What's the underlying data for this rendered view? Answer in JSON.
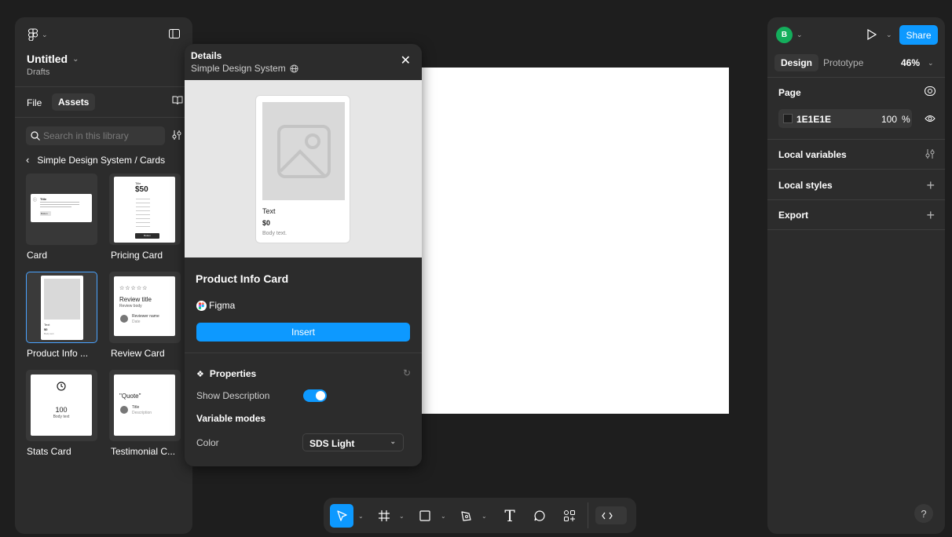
{
  "left_panel": {
    "file_title": "Untitled",
    "location": "Drafts",
    "tabs": [
      "File",
      "Assets"
    ],
    "search_placeholder": "Search in this library",
    "breadcrumb": "Simple Design System / Cards",
    "components": [
      {
        "label": "Card"
      },
      {
        "label": "Pricing Card"
      },
      {
        "label": "Product Info ..."
      },
      {
        "label": "Review Card"
      },
      {
        "label": "Stats Card"
      },
      {
        "label": "Testimonial C..."
      }
    ],
    "thumbs": {
      "card_title": "Title",
      "card_button": "Button",
      "pricing_title": "Title",
      "pricing_price": "$50",
      "pricing_button": "Button",
      "product_text": "Text",
      "product_price": "$0",
      "product_body": "Body text",
      "review_stars": "☆☆☆☆☆",
      "review_title": "Review title",
      "review_body": "Review body",
      "review_name": "Reviewer name",
      "review_date": "Date",
      "stats_value": "100",
      "stats_body": "Body text",
      "quote": "\"Quote\"",
      "quote_title": "Title",
      "quote_desc": "Description"
    }
  },
  "details": {
    "header": "Details",
    "library": "Simple Design System",
    "preview": {
      "text": "Text",
      "price": "$0",
      "body": "Body text."
    },
    "component_name": "Product Info Card",
    "author": "Figma",
    "insert_label": "Insert",
    "properties_label": "Properties",
    "show_description_label": "Show Description",
    "show_description": true,
    "variable_modes_label": "Variable modes",
    "color_label": "Color",
    "color_value": "SDS Light"
  },
  "right_panel": {
    "avatar_initial": "B",
    "share_label": "Share",
    "tabs": [
      "Design",
      "Prototype"
    ],
    "zoom": "46%",
    "page_label": "Page",
    "page_color": "1E1E1E",
    "page_opacity": "100",
    "percent_sign": "%",
    "local_variables": "Local variables",
    "local_styles": "Local styles",
    "export": "Export",
    "help": "?"
  },
  "colors": {
    "accent": "#0d99ff",
    "avatar": "#14ae5c",
    "panel": "#2c2c2c",
    "canvas": "#1e1e1e"
  }
}
